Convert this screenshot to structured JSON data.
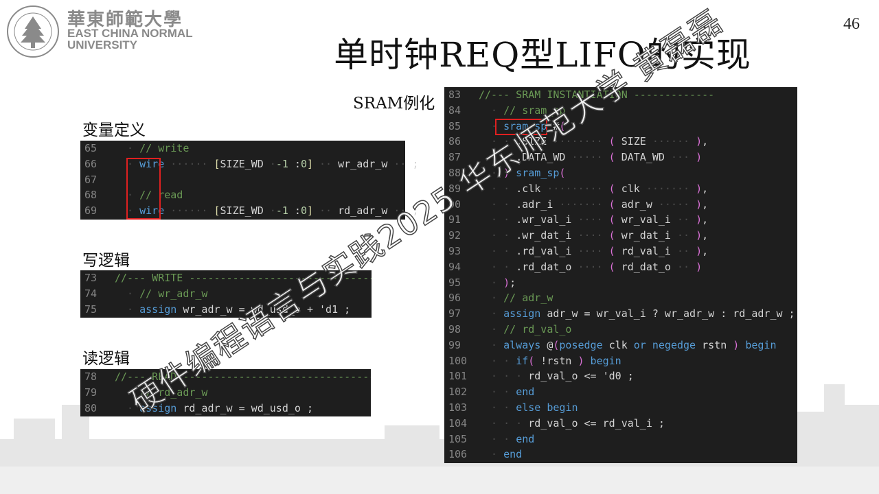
{
  "header": {
    "logo_cn": "華東師範大學",
    "logo_en_line1": "EAST CHINA NORMAL",
    "logo_en_line2": "UNIVERSITY",
    "seal_text": "EAST CHINA NORMAL UNIVERSITY",
    "page_number": "46"
  },
  "title": "单时钟REQ型LIFO的实现",
  "labels": {
    "variables": "变量定义",
    "write": "写逻辑",
    "read": "读逻辑",
    "sram": "SRAM例化"
  },
  "panels": {
    "variables": [
      {
        "n": "65",
        "t": [
          [
            "ind",
            "  · "
          ],
          [
            "c-comment",
            "// write"
          ]
        ]
      },
      {
        "n": "66",
        "t": [
          [
            "ind",
            "  · "
          ],
          [
            "c-kw",
            "wire"
          ],
          [
            "ind",
            " ······ "
          ],
          [
            "c-bracket",
            "["
          ],
          [
            "c-id",
            "SIZE_WD "
          ],
          [
            "ind",
            "·"
          ],
          [
            "c-num",
            "-1 "
          ],
          [
            "c-id",
            ":"
          ],
          [
            "c-num",
            "0"
          ],
          [
            "c-bracket",
            "]"
          ],
          [
            "ind",
            " ·· "
          ],
          [
            "c-id",
            "wr_adr_w"
          ],
          [
            "ind",
            " ·· "
          ],
          [
            "c-punct",
            ";"
          ]
        ]
      },
      {
        "n": "67",
        "t": []
      },
      {
        "n": "68",
        "t": [
          [
            "ind",
            "  · "
          ],
          [
            "c-comment",
            "// read"
          ]
        ]
      },
      {
        "n": "69",
        "t": [
          [
            "ind",
            "  · "
          ],
          [
            "c-kw",
            "wire"
          ],
          [
            "ind",
            " ······ "
          ],
          [
            "c-bracket",
            "["
          ],
          [
            "c-id",
            "SIZE_WD "
          ],
          [
            "ind",
            "·"
          ],
          [
            "c-num",
            "-1 "
          ],
          [
            "c-id",
            ":"
          ],
          [
            "c-num",
            "0"
          ],
          [
            "c-bracket",
            "]"
          ],
          [
            "ind",
            " ·· "
          ],
          [
            "c-id",
            "rd_adr_w"
          ],
          [
            "ind",
            " ·· "
          ],
          [
            "c-punct",
            ";"
          ]
        ]
      }
    ],
    "write": [
      {
        "n": "73",
        "t": [
          [
            "c-comment",
            "//--- WRITE -----------------------------------"
          ]
        ]
      },
      {
        "n": "74",
        "t": [
          [
            "ind",
            "  · "
          ],
          [
            "c-comment",
            "// wr_adr_w"
          ]
        ]
      },
      {
        "n": "75",
        "t": [
          [
            "ind",
            "  · "
          ],
          [
            "c-kw",
            "assign"
          ],
          [
            "c-id",
            " wr_adr_w = wd_usd_o + 'd1 ;"
          ]
        ]
      }
    ],
    "read": [
      {
        "n": "78",
        "t": [
          [
            "c-comment",
            "//--- READ -------------------------------------"
          ]
        ]
      },
      {
        "n": "79",
        "t": [
          [
            "ind",
            "  · "
          ],
          [
            "c-comment",
            "// rd_adr_w"
          ]
        ]
      },
      {
        "n": "80",
        "t": [
          [
            "ind",
            "  · "
          ],
          [
            "c-kw",
            "assign"
          ],
          [
            "c-id",
            " rd_adr_w = wd_usd_o ;"
          ]
        ]
      }
    ],
    "sram": [
      {
        "n": "83",
        "t": [
          [
            "c-comment",
            "//--- SRAM INSTANTIATION -------------"
          ]
        ]
      },
      {
        "n": "84",
        "t": [
          [
            "ind",
            "  · "
          ],
          [
            "c-comment",
            "// sram_sp"
          ]
        ]
      },
      {
        "n": "85",
        "t": [
          [
            "ind",
            "  · "
          ],
          [
            "c-kw",
            "sram_sp"
          ],
          [
            "c-id",
            " #"
          ],
          [
            "c-paren",
            "("
          ]
        ]
      },
      {
        "n": "86",
        "t": [
          [
            "ind",
            "  · · "
          ],
          [
            "c-id",
            ".SIZE"
          ],
          [
            "ind",
            " ········ "
          ],
          [
            "c-paren",
            "("
          ],
          [
            "c-id",
            " SIZE"
          ],
          [
            "ind",
            " ······ "
          ],
          [
            "c-paren",
            ")"
          ],
          [
            "c-id",
            ","
          ]
        ]
      },
      {
        "n": "87",
        "t": [
          [
            "ind",
            "  · · "
          ],
          [
            "c-id",
            ".DATA_WD"
          ],
          [
            "ind",
            " ····· "
          ],
          [
            "c-paren",
            "("
          ],
          [
            "c-id",
            " DATA_WD"
          ],
          [
            "ind",
            " ··· "
          ],
          [
            "c-paren",
            ")"
          ]
        ]
      },
      {
        "n": "88",
        "t": [
          [
            "ind",
            "  · "
          ],
          [
            "c-paren",
            ")"
          ],
          [
            "c-kw",
            " sram_sp"
          ],
          [
            "c-paren",
            "("
          ]
        ]
      },
      {
        "n": "89",
        "t": [
          [
            "ind",
            "  · · "
          ],
          [
            "c-id",
            ".clk"
          ],
          [
            "ind",
            " ········· "
          ],
          [
            "c-paren",
            "("
          ],
          [
            "c-id",
            " clk"
          ],
          [
            "ind",
            " ······· "
          ],
          [
            "c-paren",
            ")"
          ],
          [
            "c-id",
            ","
          ]
        ]
      },
      {
        "n": "90",
        "t": [
          [
            "ind",
            "  · · "
          ],
          [
            "c-id",
            ".adr_i"
          ],
          [
            "ind",
            " ······· "
          ],
          [
            "c-paren",
            "("
          ],
          [
            "c-id",
            " adr_w"
          ],
          [
            "ind",
            " ····· "
          ],
          [
            "c-paren",
            ")"
          ],
          [
            "c-id",
            ","
          ]
        ]
      },
      {
        "n": "91",
        "t": [
          [
            "ind",
            "  · · "
          ],
          [
            "c-id",
            ".wr_val_i"
          ],
          [
            "ind",
            " ···· "
          ],
          [
            "c-paren",
            "("
          ],
          [
            "c-id",
            " wr_val_i"
          ],
          [
            "ind",
            " ·· "
          ],
          [
            "c-paren",
            ")"
          ],
          [
            "c-id",
            ","
          ]
        ]
      },
      {
        "n": "92",
        "t": [
          [
            "ind",
            "  · · "
          ],
          [
            "c-id",
            ".wr_dat_i"
          ],
          [
            "ind",
            " ···· "
          ],
          [
            "c-paren",
            "("
          ],
          [
            "c-id",
            " wr_dat_i"
          ],
          [
            "ind",
            " ·· "
          ],
          [
            "c-paren",
            ")"
          ],
          [
            "c-id",
            ","
          ]
        ]
      },
      {
        "n": "93",
        "t": [
          [
            "ind",
            "  · · "
          ],
          [
            "c-id",
            ".rd_val_i"
          ],
          [
            "ind",
            " ···· "
          ],
          [
            "c-paren",
            "("
          ],
          [
            "c-id",
            " rd_val_i"
          ],
          [
            "ind",
            " ·· "
          ],
          [
            "c-paren",
            ")"
          ],
          [
            "c-id",
            ","
          ]
        ]
      },
      {
        "n": "94",
        "t": [
          [
            "ind",
            "  · · "
          ],
          [
            "c-id",
            ".rd_dat_o"
          ],
          [
            "ind",
            " ···· "
          ],
          [
            "c-paren",
            "("
          ],
          [
            "c-id",
            " rd_dat_o"
          ],
          [
            "ind",
            " ·· "
          ],
          [
            "c-paren",
            ")"
          ]
        ]
      },
      {
        "n": "95",
        "t": [
          [
            "ind",
            "  · "
          ],
          [
            "c-paren",
            ")"
          ],
          [
            "c-id",
            ";"
          ]
        ]
      },
      {
        "n": "96",
        "t": [
          [
            "ind",
            "  · "
          ],
          [
            "c-comment",
            "// adr_w"
          ]
        ]
      },
      {
        "n": "97",
        "t": [
          [
            "ind",
            "  · "
          ],
          [
            "c-kw",
            "assign"
          ],
          [
            "c-id",
            " adr_w = wr_val_i ? wr_adr_w : rd_adr_w ;"
          ]
        ]
      },
      {
        "n": "98",
        "t": [
          [
            "ind",
            "  · "
          ],
          [
            "c-comment",
            "// rd_val_o"
          ]
        ]
      },
      {
        "n": "99",
        "t": [
          [
            "ind",
            "  · "
          ],
          [
            "c-kw",
            "always"
          ],
          [
            "c-id",
            " @"
          ],
          [
            "c-paren",
            "("
          ],
          [
            "c-kw",
            "posedge"
          ],
          [
            "c-id",
            " clk "
          ],
          [
            "c-kw",
            "or"
          ],
          [
            "c-kw",
            " negedge"
          ],
          [
            "c-id",
            " rstn "
          ],
          [
            "c-paren",
            ")"
          ],
          [
            "c-kw",
            " begin"
          ]
        ]
      },
      {
        "n": "100",
        "t": [
          [
            "ind",
            "  · · "
          ],
          [
            "c-kw",
            "if"
          ],
          [
            "c-paren",
            "("
          ],
          [
            "c-id",
            " !rstn "
          ],
          [
            "c-paren",
            ")"
          ],
          [
            "c-kw",
            " begin"
          ]
        ]
      },
      {
        "n": "101",
        "t": [
          [
            "ind",
            "  · · · "
          ],
          [
            "c-id",
            "rd_val_o <= 'd0 ;"
          ]
        ]
      },
      {
        "n": "102",
        "t": [
          [
            "ind",
            "  · · "
          ],
          [
            "c-kw",
            "end"
          ]
        ]
      },
      {
        "n": "103",
        "t": [
          [
            "ind",
            "  · · "
          ],
          [
            "c-kw",
            "else"
          ],
          [
            "c-kw",
            " begin"
          ]
        ]
      },
      {
        "n": "104",
        "t": [
          [
            "ind",
            "  · · · "
          ],
          [
            "c-id",
            "rd_val_o <= rd_val_i ;"
          ]
        ]
      },
      {
        "n": "105",
        "t": [
          [
            "ind",
            "  · · "
          ],
          [
            "c-kw",
            "end"
          ]
        ]
      },
      {
        "n": "106",
        "t": [
          [
            "ind",
            "  · "
          ],
          [
            "c-kw",
            "end"
          ]
        ]
      }
    ]
  },
  "watermark": "硬件编程语言与实践2025 华东师范大学 黄磊磊",
  "colors": {
    "code_bg": "#1e1e1e",
    "keyword": "#569cd6",
    "comment": "#6a9955",
    "highlight_box": "#e02020"
  }
}
